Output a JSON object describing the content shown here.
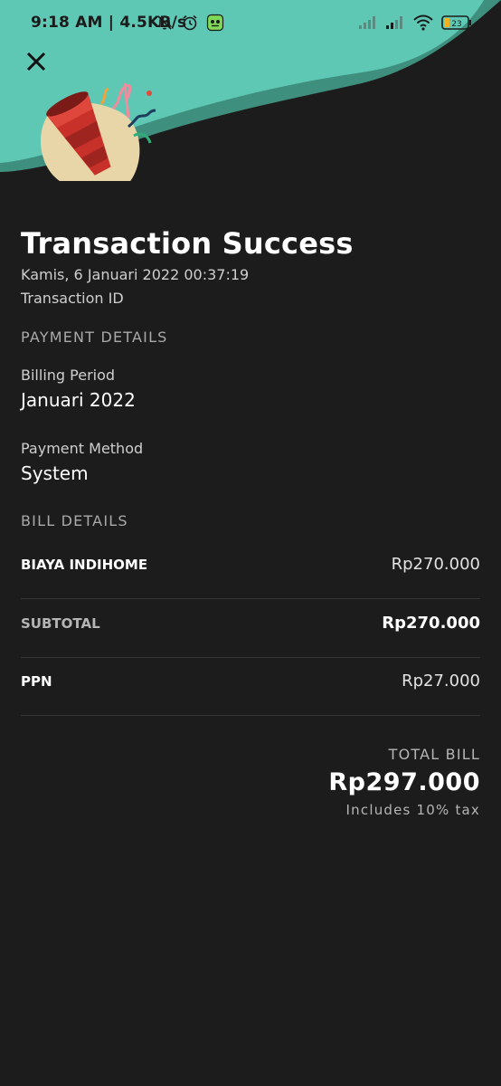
{
  "status_bar": {
    "time": "9:18 AM | 4.5KB/s",
    "battery_level": "23",
    "icons": [
      "bell-off-icon",
      "alarm-icon",
      "app-notification-icon",
      "signal-icon",
      "signal-icon",
      "wifi-icon",
      "battery-icon"
    ]
  },
  "header": {
    "close_icon": "close-icon",
    "illustration": "party-popper",
    "colors": {
      "wave": "#5ec8b4",
      "wave_shadow": "#3f8f7e",
      "popper": "#c8302a",
      "blob": "#e9d6a8"
    }
  },
  "transaction": {
    "title": "Transaction Success",
    "datetime": "Kamis, 6 Januari 2022 00:37:19",
    "id_label": "Transaction ID"
  },
  "payment_details": {
    "heading": "PAYMENT DETAILS",
    "billing_period_label": "Billing Period",
    "billing_period_value": "Januari 2022",
    "payment_method_label": "Payment Method",
    "payment_method_value": "System"
  },
  "bill_details": {
    "heading": "BILL DETAILS",
    "rows": [
      {
        "label": "BIAYA INDIHOME",
        "amount": "Rp270.000"
      },
      {
        "label": "SUBTOTAL",
        "amount": "Rp270.000"
      },
      {
        "label": "PPN",
        "amount": "Rp27.000"
      }
    ]
  },
  "total": {
    "label": "TOTAL BILL",
    "value": "Rp297.000",
    "note": "Includes 10% tax"
  }
}
